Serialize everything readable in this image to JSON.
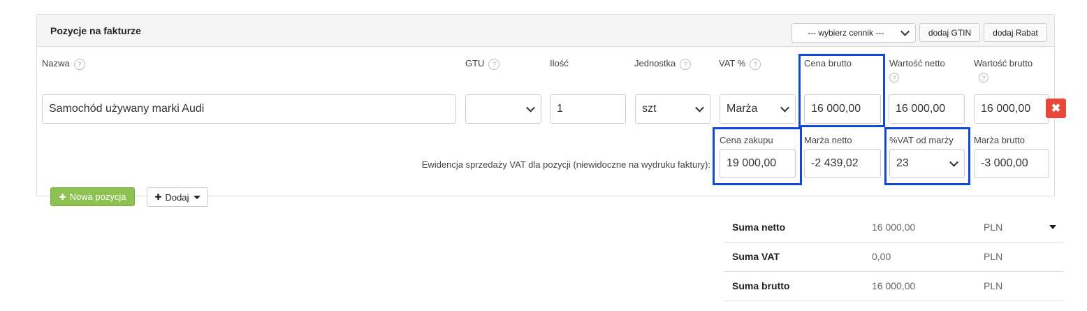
{
  "panel": {
    "title": "Pozycje na fakturze",
    "price_list_select": "--- wybierz cennik ---",
    "add_gtin_label": "dodaj GTIN",
    "add_discount_label": "dodaj Rabat"
  },
  "columns": {
    "name": "Nazwa",
    "gtu": "GTU",
    "quantity": "Ilość",
    "unit": "Jednostka",
    "vat": "VAT %",
    "gross_price": "Cena brutto",
    "net_value": "Wartość netto",
    "gross_value": "Wartość brutto"
  },
  "help_icon": "?",
  "row": {
    "name": "Samochód używany marki Audi",
    "gtu": "",
    "quantity": "1",
    "unit": "szt",
    "vat": "Marża",
    "gross_price": "16 000,00",
    "net_value": "16 000,00",
    "gross_value": "16 000,00",
    "delete_symbol": "✖"
  },
  "margin_section": {
    "note": "Ewidencja sprzedaży VAT dla pozycji (niewidoczne na wydruku faktury):",
    "purchase_price_label": "Cena zakupu",
    "purchase_price": "19 000,00",
    "net_margin_label": "Marża netto",
    "net_margin": "-2 439,02",
    "vat_on_margin_label": "%VAT od marży",
    "vat_on_margin": "23",
    "gross_margin_label": "Marża brutto",
    "gross_margin": "-3 000,00"
  },
  "actions": {
    "new_item_label": "Nowa pozycja",
    "new_item_icon": "✚",
    "add_label": "Dodaj",
    "add_icon": "✚"
  },
  "summary": {
    "rows": [
      {
        "label": "Suma netto",
        "value": "16 000,00",
        "currency": "PLN"
      },
      {
        "label": "Suma VAT",
        "value": "0,00",
        "currency": "PLN"
      },
      {
        "label": "Suma brutto",
        "value": "16 000,00",
        "currency": "PLN"
      }
    ]
  },
  "colors": {
    "highlight": "#1048d8",
    "delete": "#e8483a",
    "new_item": "#8dc152"
  }
}
